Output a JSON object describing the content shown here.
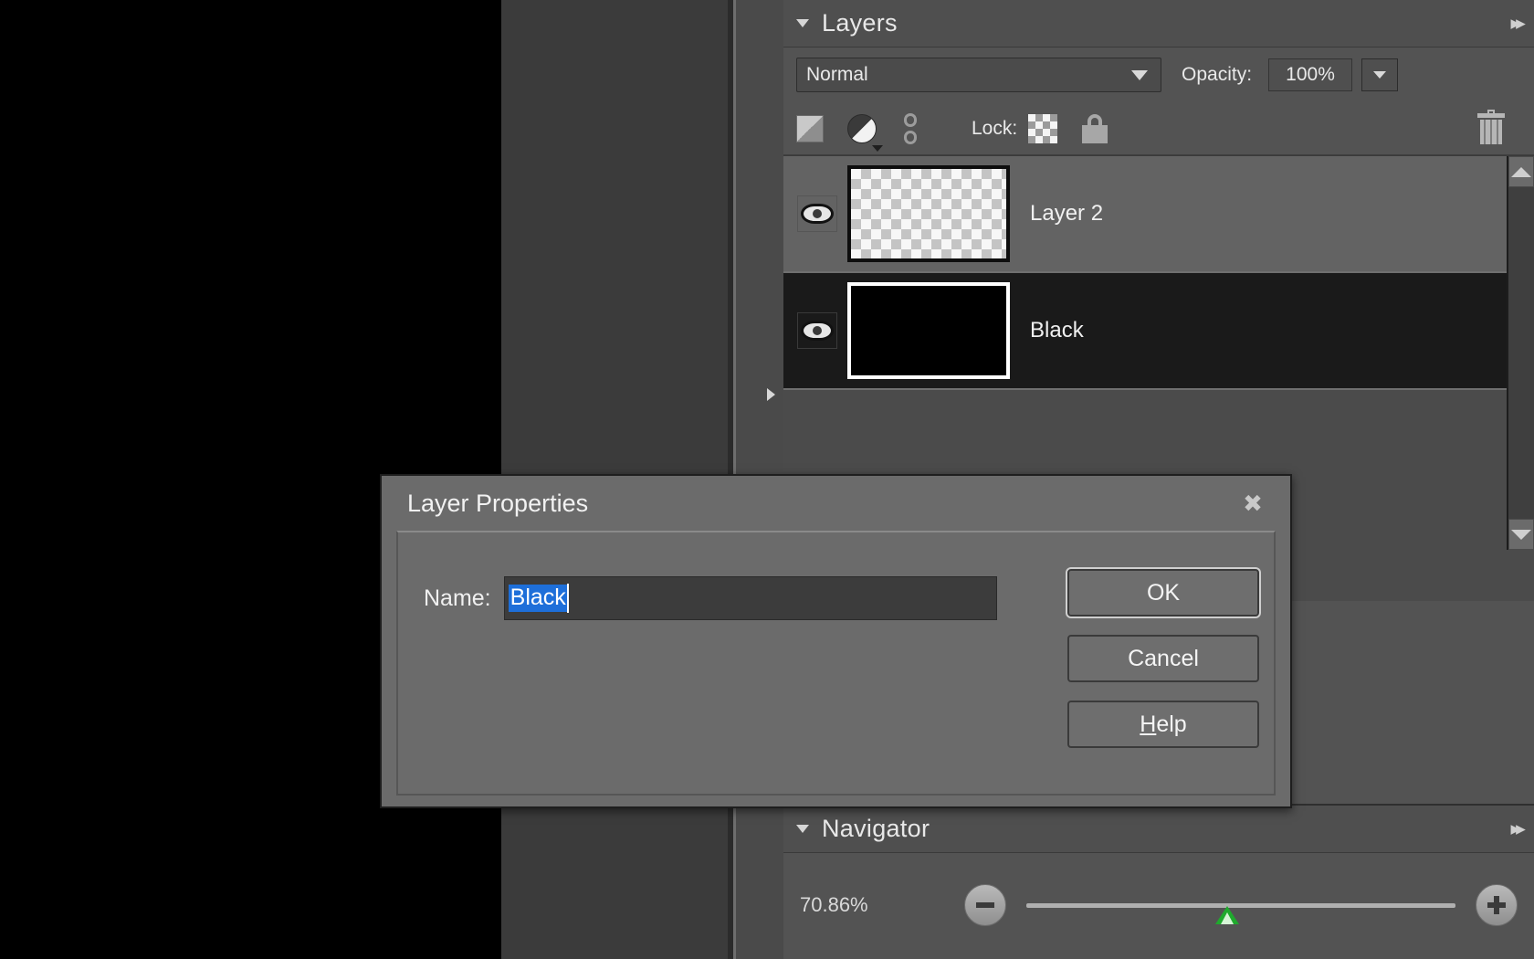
{
  "workspace": {
    "canvas_region": "black-canvas",
    "expander_icon": "right-arrow-icon"
  },
  "layers_panel": {
    "title": "Layers",
    "disclosure_icon": "triangle-down-icon",
    "more_icon": "double-chevron-right-icon",
    "blend_mode": {
      "value": "Normal",
      "caret_icon": "chevron-down-icon"
    },
    "opacity": {
      "label": "Opacity:",
      "value": "100%",
      "stepper_icon": "chevron-down-icon"
    },
    "toolbar_icons": {
      "layer_style": "layer-style-icon",
      "adjustment": "adjustment-half-circle-icon",
      "adjustment_dropdown": "triangle-down-icon",
      "link": "link-chain-icon",
      "lock_label": "Lock:",
      "lock_transparency": "checkerboard-icon",
      "lock_all": "padlock-icon",
      "delete": "trash-icon"
    },
    "rows": [
      {
        "name": "Layer 2",
        "visibility_icon": "eye-icon",
        "visible": true,
        "thumbnail": "transparent-checkerboard",
        "selected": false
      },
      {
        "name": "Black",
        "visibility_icon": "eye-icon",
        "visible": true,
        "thumbnail": "solid-black",
        "selected": true
      }
    ],
    "scrollbar": {
      "up_icon": "triangle-up-icon",
      "down_icon": "triangle-down-icon"
    }
  },
  "navigator_panel": {
    "title": "Navigator",
    "disclosure_icon": "triangle-down-icon",
    "more_icon": "double-chevron-right-icon",
    "zoom_value": "70.86%",
    "zoom_out_icon": "minus-circle-icon",
    "zoom_in_icon": "plus-circle-icon",
    "slider_handle_color": "#1faa2d",
    "slider_position_percent": 44
  },
  "dialog": {
    "title": "Layer Properties",
    "close_icon": "close-x-icon",
    "name_label": "Name:",
    "name_value": "Black",
    "name_selected": true,
    "selection_color": "#1e6fd9",
    "buttons": [
      {
        "label": "OK",
        "mnemonic": "",
        "primary": true
      },
      {
        "label": "Cancel",
        "mnemonic": "",
        "primary": false
      },
      {
        "label": "Help",
        "mnemonic": "H",
        "primary": false
      }
    ]
  }
}
